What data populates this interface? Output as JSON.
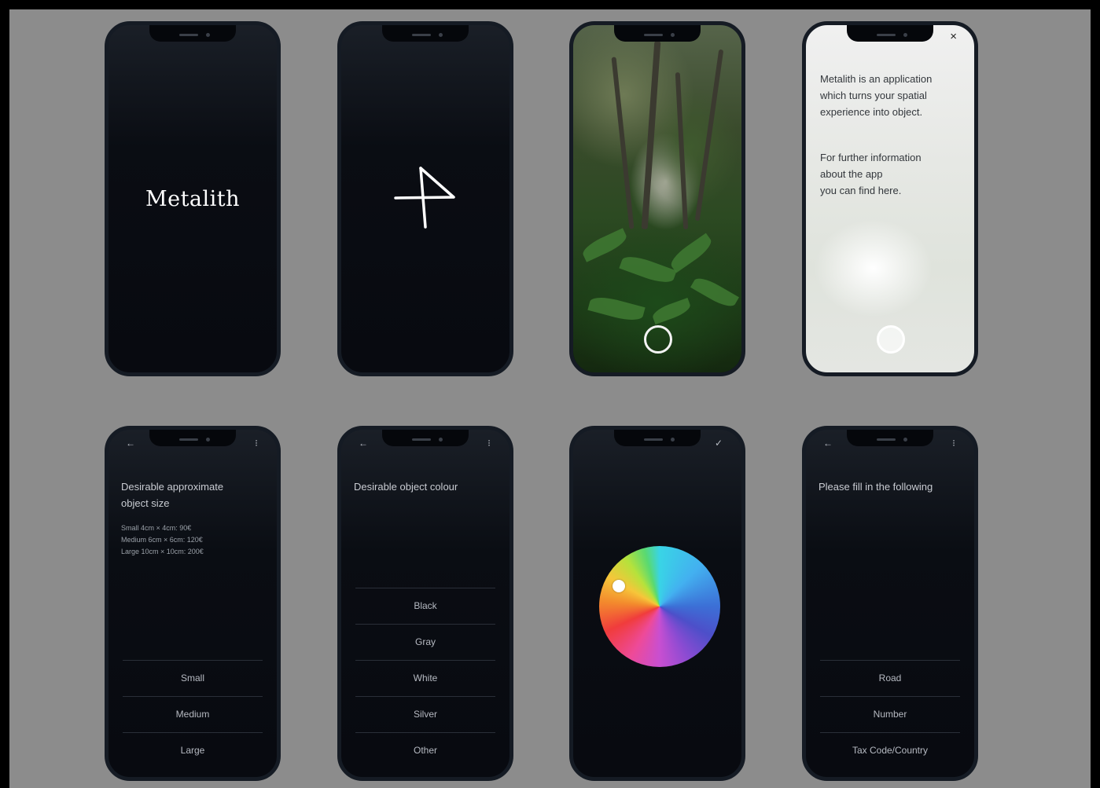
{
  "screens": {
    "splash": {
      "title": "Metalith"
    },
    "logo_mark": {
      "icon": "metalith-symbol-icon"
    },
    "camera": {
      "shutter_icon": "shutter-button-icon"
    },
    "info": {
      "close": "×",
      "paragraph_1": [
        "Metalith is an application",
        "which turns your spatial",
        "experience into object."
      ],
      "paragraph_2": [
        "For further information",
        "about the app",
        "you can find here."
      ]
    },
    "size": {
      "back": "←",
      "more": "⁝",
      "title_1": "Desirable approximate",
      "title_2": "object size",
      "prices": [
        "Small 4cm × 4cm: 90€",
        "Medium 6cm × 6cm: 120€",
        "Large 10cm × 10cm: 200€"
      ],
      "options": [
        "Small",
        "Medium",
        "Large"
      ]
    },
    "colour": {
      "back": "←",
      "more": "⁝",
      "title": "Desirable object colour",
      "options": [
        "Black",
        "Gray",
        "White",
        "Silver",
        "Other"
      ]
    },
    "picker": {
      "confirm": "✓"
    },
    "form": {
      "back": "←",
      "more": "⁝",
      "title": "Please fill in the following",
      "options": [
        "Road",
        "Number",
        "Tax Code/Country"
      ]
    }
  },
  "colors": {
    "board": "#8c8c8c",
    "phone": "#0a0d13",
    "frame": "#151b24"
  }
}
